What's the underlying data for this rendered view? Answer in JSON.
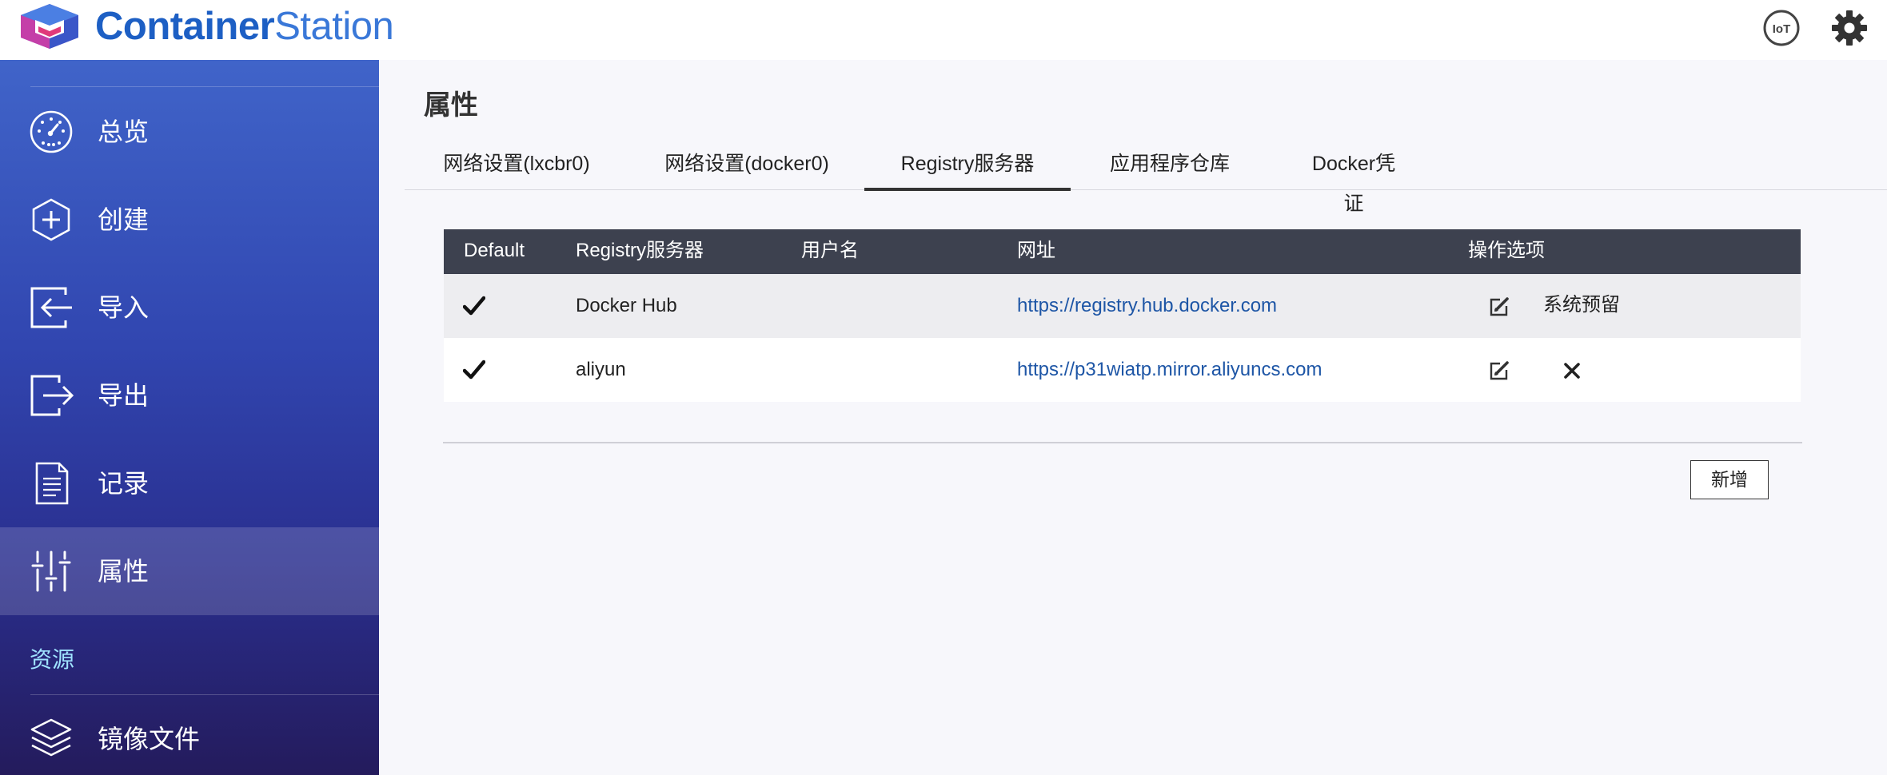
{
  "app": {
    "logo_primary": "Container",
    "logo_secondary": "Station",
    "brand_color": "#1d5fc4",
    "iot_label": "IoT"
  },
  "header": {
    "icons": [
      "iot-icon",
      "gear-icon"
    ]
  },
  "sidebar": {
    "items": [
      {
        "label": "总览",
        "icon": "dashboard-gauge-icon"
      },
      {
        "label": "创建",
        "icon": "plus-hexagon-icon"
      },
      {
        "label": "导入",
        "icon": "import-arrow-icon"
      },
      {
        "label": "导出",
        "icon": "export-arrow-icon"
      },
      {
        "label": "记录",
        "icon": "document-list-icon"
      },
      {
        "label": "属性",
        "icon": "sliders-icon",
        "active": true
      }
    ],
    "section_label": "资源",
    "section_items": [
      {
        "label": "镜像文件",
        "icon": "layers-stack-icon"
      }
    ]
  },
  "main": {
    "title": "属性",
    "tabs": [
      {
        "label": "网络设置(lxcbr0)"
      },
      {
        "label": "网络设置(docker0)"
      },
      {
        "label": "Registry服务器",
        "active": true
      },
      {
        "label": "应用程序仓库"
      },
      {
        "label": "Docker凭证"
      }
    ],
    "table": {
      "headers": [
        "Default",
        "Registry服务器",
        "用户名",
        "网址",
        "操作选项"
      ],
      "rows": [
        {
          "default": true,
          "server": "Docker Hub",
          "username": "",
          "url": "https://registry.hub.docker.com",
          "action_note": "系统预留"
        },
        {
          "default": true,
          "server": "aliyun",
          "username": "",
          "url": "https://p31wiatp.mirror.aliyuncs.com",
          "action_note": ""
        }
      ]
    },
    "add_button": "新增"
  }
}
